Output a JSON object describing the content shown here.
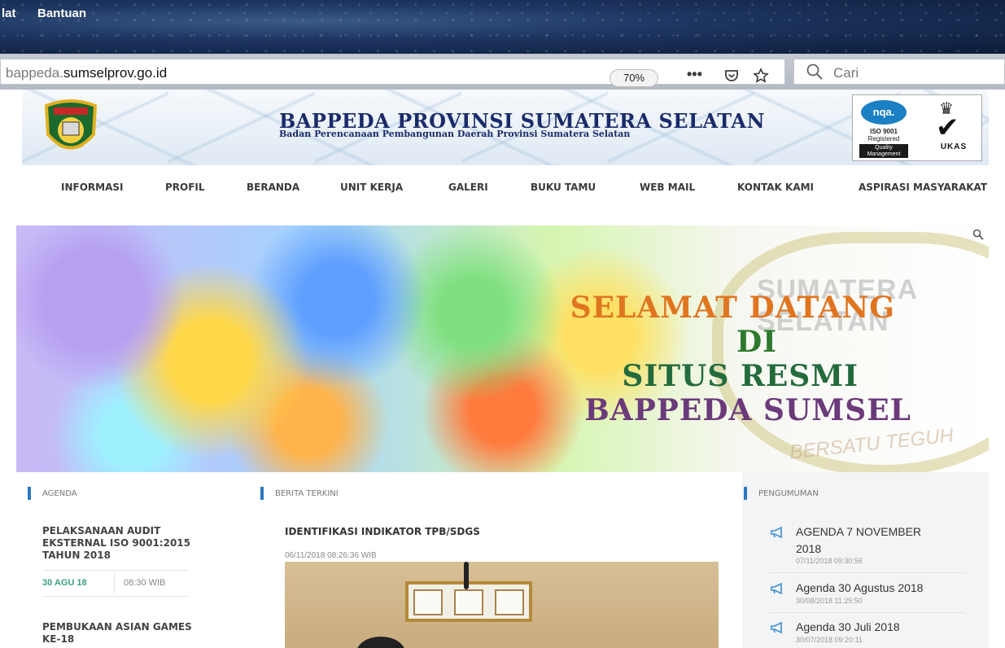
{
  "browser": {
    "menu": [
      "lat",
      "Bantuan"
    ],
    "url_prefix": "bappeda.",
    "url_domain": "sumselprov.go.id",
    "zoom": "70%",
    "overflow_icon": "more-icon",
    "search_placeholder": "Cari"
  },
  "header": {
    "title": "BAPPEDA PROVINSI SUMATERA SELATAN",
    "subtitle": "Badan Perencanaan Pembangunan Daerah Provinsi Sumatera Selatan",
    "cert": {
      "nqa": "nqa.",
      "iso": "ISO 9001",
      "registered": "Registered",
      "quality": "Quality",
      "management": "Management",
      "ukas": "UKAS"
    }
  },
  "nav": [
    "INFORMASI",
    "PROFIL",
    "BERANDA",
    "UNIT KERJA",
    "GALERI",
    "BUKU TAMU",
    "WEB MAIL",
    "KONTAK KAMI",
    "ASPIRASI MASYARAKAT"
  ],
  "banner": {
    "line1": "SELAMAT DATANG",
    "line2": "DI",
    "line3": "SITUS RESMI",
    "line4": "BAPPEDA SUMSEL",
    "emblem_top": "SUMATERA SELATAN",
    "emblem_bottom": "BERSATU TEGUH"
  },
  "agenda": {
    "label": "AGENDA",
    "items": [
      {
        "title": "PELAKSANAAN AUDIT EKSTERNAL ISO 9001:2015 TAHUN 2018",
        "date": "30 AGU 18",
        "time": "08:30 WIB"
      },
      {
        "title": "PEMBUKAAN ASIAN GAMES KE-18"
      }
    ]
  },
  "news": {
    "label": "BERITA TERKINI",
    "title": "IDENTIFIKASI INDIKATOR TPB/SDGS",
    "time": "06/11/2018 08:26:36 WIB"
  },
  "announcements": {
    "label": "PENGUMUMAN",
    "items": [
      {
        "title_line1": "AGENDA 7 NOVEMBER",
        "title_line2": "2018",
        "date": "07/11/2018 09:30:56"
      },
      {
        "title": "Agenda 30 Agustus 2018",
        "date": "30/08/2018 11:25:50"
      },
      {
        "title": "Agenda 30 Juli 2018",
        "date": "30/07/2018 09:20:11"
      }
    ]
  }
}
